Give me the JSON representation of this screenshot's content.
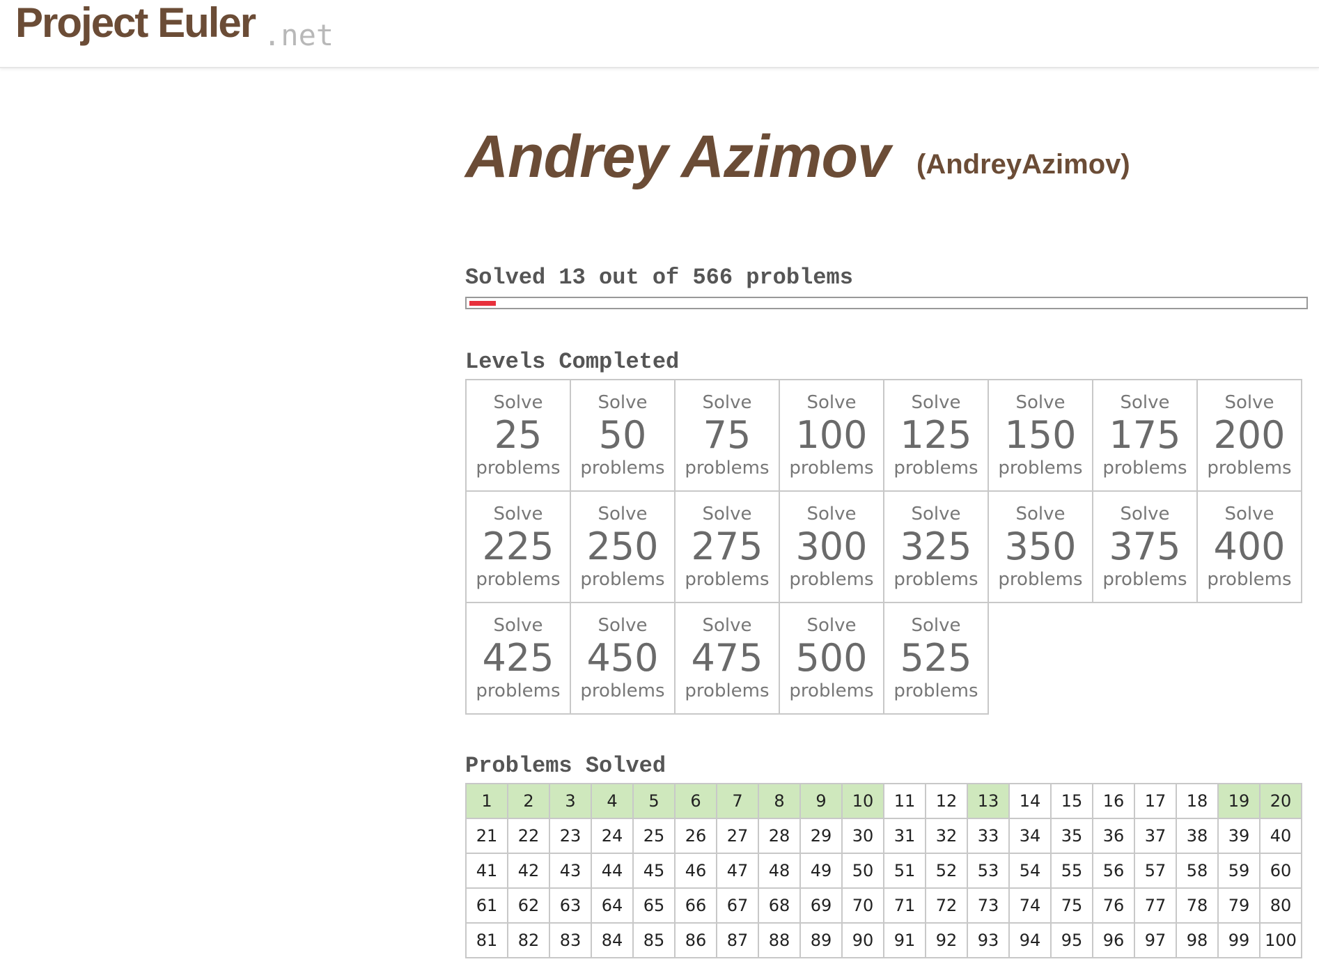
{
  "header": {
    "logo_main": "Project Euler",
    "logo_suffix": ".net"
  },
  "profile": {
    "name": "Andrey Azimov",
    "alias": "(AndreyAzimov)"
  },
  "progress": {
    "label": "Solved 13 out of 566 problems",
    "solved": 13,
    "total": 566,
    "bar_color": "#e8303c"
  },
  "levels": {
    "heading": "Levels Completed",
    "items": [
      {
        "top": "Solve",
        "number": "25",
        "bottom": "problems"
      },
      {
        "top": "Solve",
        "number": "50",
        "bottom": "problems"
      },
      {
        "top": "Solve",
        "number": "75",
        "bottom": "problems"
      },
      {
        "top": "Solve",
        "number": "100",
        "bottom": "problems"
      },
      {
        "top": "Solve",
        "number": "125",
        "bottom": "problems"
      },
      {
        "top": "Solve",
        "number": "150",
        "bottom": "problems"
      },
      {
        "top": "Solve",
        "number": "175",
        "bottom": "problems"
      },
      {
        "top": "Solve",
        "number": "200",
        "bottom": "problems"
      },
      {
        "top": "Solve",
        "number": "225",
        "bottom": "problems"
      },
      {
        "top": "Solve",
        "number": "250",
        "bottom": "problems"
      },
      {
        "top": "Solve",
        "number": "275",
        "bottom": "problems"
      },
      {
        "top": "Solve",
        "number": "300",
        "bottom": "problems"
      },
      {
        "top": "Solve",
        "number": "325",
        "bottom": "problems"
      },
      {
        "top": "Solve",
        "number": "350",
        "bottom": "problems"
      },
      {
        "top": "Solve",
        "number": "375",
        "bottom": "problems"
      },
      {
        "top": "Solve",
        "number": "400",
        "bottom": "problems"
      },
      {
        "top": "Solve",
        "number": "425",
        "bottom": "problems"
      },
      {
        "top": "Solve",
        "number": "450",
        "bottom": "problems"
      },
      {
        "top": "Solve",
        "number": "475",
        "bottom": "problems"
      },
      {
        "top": "Solve",
        "number": "500",
        "bottom": "problems"
      },
      {
        "top": "Solve",
        "number": "525",
        "bottom": "problems"
      }
    ]
  },
  "problems": {
    "heading": "Problems Solved",
    "solved_color": "#cfe8bd",
    "items": [
      {
        "n": "1",
        "solved": true
      },
      {
        "n": "2",
        "solved": true
      },
      {
        "n": "3",
        "solved": true
      },
      {
        "n": "4",
        "solved": true
      },
      {
        "n": "5",
        "solved": true
      },
      {
        "n": "6",
        "solved": true
      },
      {
        "n": "7",
        "solved": true
      },
      {
        "n": "8",
        "solved": true
      },
      {
        "n": "9",
        "solved": true
      },
      {
        "n": "10",
        "solved": true
      },
      {
        "n": "11",
        "solved": false
      },
      {
        "n": "12",
        "solved": false
      },
      {
        "n": "13",
        "solved": true
      },
      {
        "n": "14",
        "solved": false
      },
      {
        "n": "15",
        "solved": false
      },
      {
        "n": "16",
        "solved": false
      },
      {
        "n": "17",
        "solved": false
      },
      {
        "n": "18",
        "solved": false
      },
      {
        "n": "19",
        "solved": true
      },
      {
        "n": "20",
        "solved": true
      },
      {
        "n": "21",
        "solved": false
      },
      {
        "n": "22",
        "solved": false
      },
      {
        "n": "23",
        "solved": false
      },
      {
        "n": "24",
        "solved": false
      },
      {
        "n": "25",
        "solved": false
      },
      {
        "n": "26",
        "solved": false
      },
      {
        "n": "27",
        "solved": false
      },
      {
        "n": "28",
        "solved": false
      },
      {
        "n": "29",
        "solved": false
      },
      {
        "n": "30",
        "solved": false
      },
      {
        "n": "31",
        "solved": false
      },
      {
        "n": "32",
        "solved": false
      },
      {
        "n": "33",
        "solved": false
      },
      {
        "n": "34",
        "solved": false
      },
      {
        "n": "35",
        "solved": false
      },
      {
        "n": "36",
        "solved": false
      },
      {
        "n": "37",
        "solved": false
      },
      {
        "n": "38",
        "solved": false
      },
      {
        "n": "39",
        "solved": false
      },
      {
        "n": "40",
        "solved": false
      },
      {
        "n": "41",
        "solved": false
      },
      {
        "n": "42",
        "solved": false
      },
      {
        "n": "43",
        "solved": false
      },
      {
        "n": "44",
        "solved": false
      },
      {
        "n": "45",
        "solved": false
      },
      {
        "n": "46",
        "solved": false
      },
      {
        "n": "47",
        "solved": false
      },
      {
        "n": "48",
        "solved": false
      },
      {
        "n": "49",
        "solved": false
      },
      {
        "n": "50",
        "solved": false
      },
      {
        "n": "51",
        "solved": false
      },
      {
        "n": "52",
        "solved": false
      },
      {
        "n": "53",
        "solved": false
      },
      {
        "n": "54",
        "solved": false
      },
      {
        "n": "55",
        "solved": false
      },
      {
        "n": "56",
        "solved": false
      },
      {
        "n": "57",
        "solved": false
      },
      {
        "n": "58",
        "solved": false
      },
      {
        "n": "59",
        "solved": false
      },
      {
        "n": "60",
        "solved": false
      },
      {
        "n": "61",
        "solved": false
      },
      {
        "n": "62",
        "solved": false
      },
      {
        "n": "63",
        "solved": false
      },
      {
        "n": "64",
        "solved": false
      },
      {
        "n": "65",
        "solved": false
      },
      {
        "n": "66",
        "solved": false
      },
      {
        "n": "67",
        "solved": false
      },
      {
        "n": "68",
        "solved": false
      },
      {
        "n": "69",
        "solved": false
      },
      {
        "n": "70",
        "solved": false
      },
      {
        "n": "71",
        "solved": false
      },
      {
        "n": "72",
        "solved": false
      },
      {
        "n": "73",
        "solved": false
      },
      {
        "n": "74",
        "solved": false
      },
      {
        "n": "75",
        "solved": false
      },
      {
        "n": "76",
        "solved": false
      },
      {
        "n": "77",
        "solved": false
      },
      {
        "n": "78",
        "solved": false
      },
      {
        "n": "79",
        "solved": false
      },
      {
        "n": "80",
        "solved": false
      },
      {
        "n": "81",
        "solved": false
      },
      {
        "n": "82",
        "solved": false
      },
      {
        "n": "83",
        "solved": false
      },
      {
        "n": "84",
        "solved": false
      },
      {
        "n": "85",
        "solved": false
      },
      {
        "n": "86",
        "solved": false
      },
      {
        "n": "87",
        "solved": false
      },
      {
        "n": "88",
        "solved": false
      },
      {
        "n": "89",
        "solved": false
      },
      {
        "n": "90",
        "solved": false
      },
      {
        "n": "91",
        "solved": false
      },
      {
        "n": "92",
        "solved": false
      },
      {
        "n": "93",
        "solved": false
      },
      {
        "n": "94",
        "solved": false
      },
      {
        "n": "95",
        "solved": false
      },
      {
        "n": "96",
        "solved": false
      },
      {
        "n": "97",
        "solved": false
      },
      {
        "n": "98",
        "solved": false
      },
      {
        "n": "99",
        "solved": false
      },
      {
        "n": "100",
        "solved": false
      }
    ]
  }
}
